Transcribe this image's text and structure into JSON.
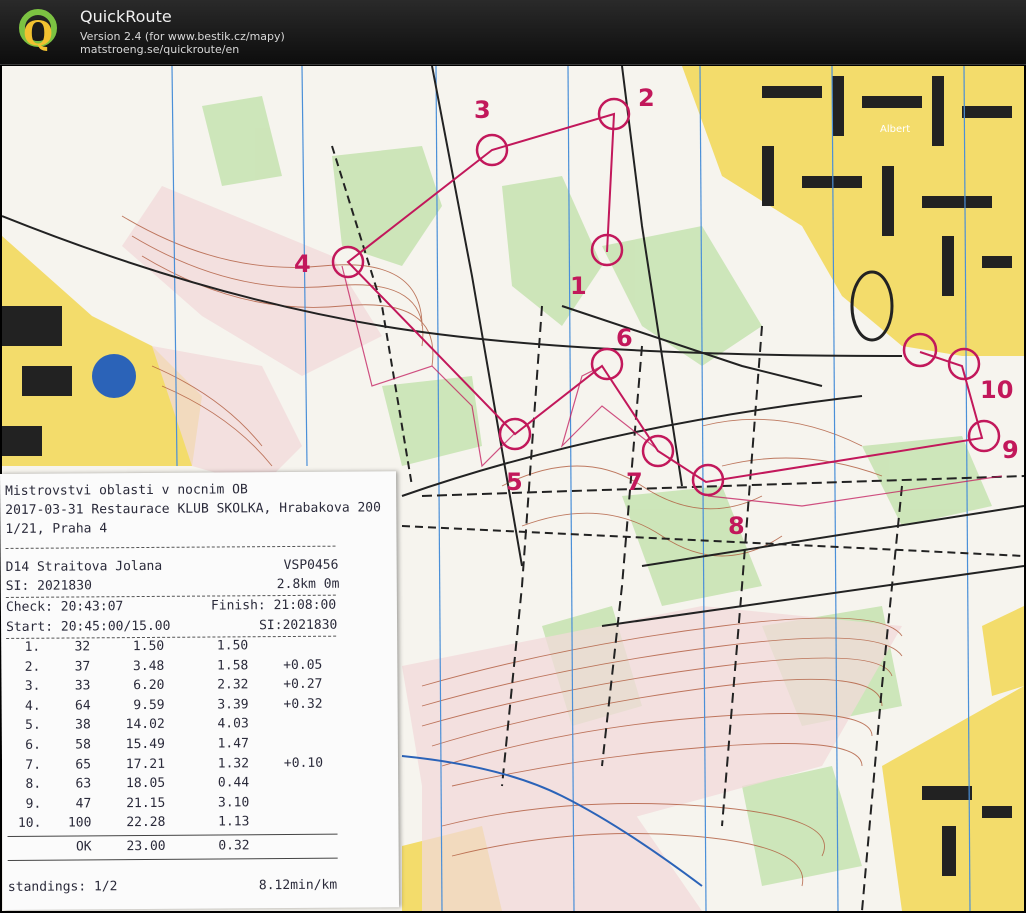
{
  "window": {
    "title": "QuickRoute",
    "version": "Version 2.4  (for www.bestik.cz/mapy)",
    "url": "matstroeng.se/quickroute/en",
    "logo_letter": "Q"
  },
  "map": {
    "route_color": "#c2185b",
    "control_labels": [
      "1",
      "2",
      "3",
      "4",
      "5",
      "6",
      "7",
      "8",
      "9",
      "10"
    ],
    "place_labels": {
      "shop": "Albert"
    }
  },
  "receipt": {
    "event_title": "Mistrovstvi oblasti v nocnim OB",
    "event_line2": "2017-03-31 Restaurace KLUB SKOLKA, Hrabakova 200",
    "event_line3": "1/21, Praha 4",
    "category_name": "D14 Straitova Jolana",
    "club": "VSP0456",
    "si": "SI: 2021830",
    "distance": "2.8km 0m",
    "check": "Check: 20:43:07",
    "finish": "Finish: 21:08:00",
    "start": "Start: 20:45:00/15.00",
    "si_right": "SI:2021830",
    "splits": [
      {
        "idx": "1.",
        "code": "32",
        "cum": "1.50",
        "leg": "1.50",
        "behind": ""
      },
      {
        "idx": "2.",
        "code": "37",
        "cum": "3.48",
        "leg": "1.58",
        "behind": "+0.05"
      },
      {
        "idx": "3.",
        "code": "33",
        "cum": "6.20",
        "leg": "2.32",
        "behind": "+0.27"
      },
      {
        "idx": "4.",
        "code": "64",
        "cum": "9.59",
        "leg": "3.39",
        "behind": "+0.32"
      },
      {
        "idx": "5.",
        "code": "38",
        "cum": "14.02",
        "leg": "4.03",
        "behind": ""
      },
      {
        "idx": "6.",
        "code": "58",
        "cum": "15.49",
        "leg": "1.47",
        "behind": ""
      },
      {
        "idx": "7.",
        "code": "65",
        "cum": "17.21",
        "leg": "1.32",
        "behind": "+0.10"
      },
      {
        "idx": "8.",
        "code": "63",
        "cum": "18.05",
        "leg": "0.44",
        "behind": ""
      },
      {
        "idx": "9.",
        "code": "47",
        "cum": "21.15",
        "leg": "3.10",
        "behind": ""
      },
      {
        "idx": "10.",
        "code": "100",
        "cum": "22.28",
        "leg": "1.13",
        "behind": ""
      }
    ],
    "finish_row": {
      "code": "OK",
      "cum": "23.00",
      "leg": "0.32"
    },
    "standings": "standings: 1/2",
    "pace": "8.12min/km"
  }
}
